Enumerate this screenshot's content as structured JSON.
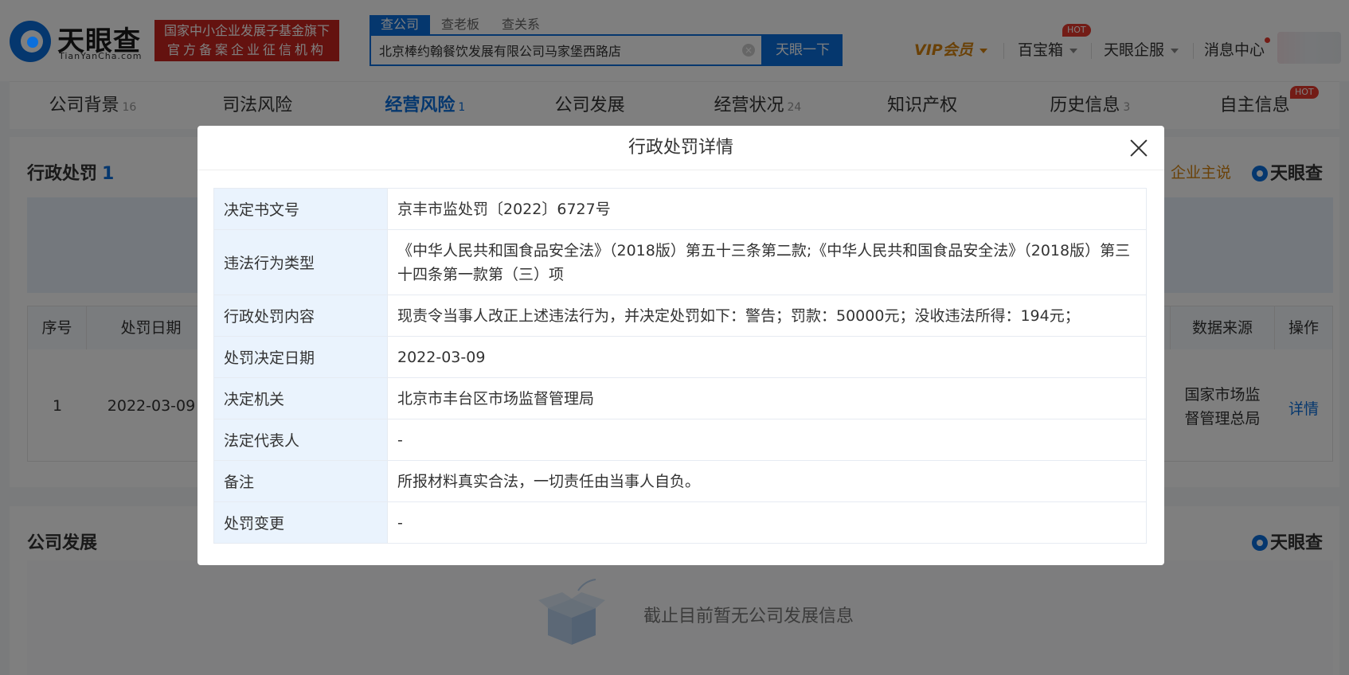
{
  "header": {
    "logo_text": "天眼查",
    "logo_sub": "TianYanCha.com",
    "badge_line1": "国家中小企业发展子基金旗下",
    "badge_line2": "官方备案企业征信机构",
    "search_tabs": [
      "查公司",
      "查老板",
      "查关系"
    ],
    "search_value": "北京棒约翰餐饮发展有限公司马家堡西路店",
    "search_clear": "×",
    "search_button": "天眼一下",
    "nav": {
      "vip": "VIP会员",
      "baobao": "百宝箱",
      "qifu": "天眼企服",
      "messages": "消息中心",
      "hot": "HOT"
    }
  },
  "tabs": [
    {
      "label": "公司背景",
      "count": "16"
    },
    {
      "label": "司法风险",
      "count": ""
    },
    {
      "label": "经营风险",
      "count": "1"
    },
    {
      "label": "公司发展",
      "count": ""
    },
    {
      "label": "经营状况",
      "count": "24"
    },
    {
      "label": "知识产权",
      "count": ""
    },
    {
      "label": "历史信息",
      "count": "3"
    },
    {
      "label": "自主信息",
      "count": ""
    }
  ],
  "tab_hot": "HOT",
  "penalty_section": {
    "title": "行政处罚",
    "count": "1",
    "qiye_zhushuo": "企业主说",
    "brand": "天眼查",
    "table_headers": {
      "index": "序号",
      "date": "处罚日期",
      "source": "数据来源",
      "action": "操作"
    },
    "row": {
      "index": "1",
      "date": "2022-03-09",
      "source_line1": "国家市场监",
      "source_line2": "督管理总局",
      "action": "详情"
    }
  },
  "dev_section": {
    "title": "公司发展",
    "brand": "天眼查",
    "empty_text": "截止目前暂无公司发展信息"
  },
  "modal": {
    "title": "行政处罚详情",
    "rows": [
      {
        "label": "决定书文号",
        "value": "京丰市监处罚〔2022〕6727号"
      },
      {
        "label": "违法行为类型",
        "value": "《中华人民共和国食品安全法》（2018版）第五十三条第二款;《中华人民共和国食品安全法》（2018版）第三十四条第一款第（三）项"
      },
      {
        "label": "行政处罚内容",
        "value": "现责令当事人改正上述违法行为，并决定处罚如下：警告；罚款：50000元；没收违法所得：194元；"
      },
      {
        "label": "处罚决定日期",
        "value": "2022-03-09"
      },
      {
        "label": "决定机关",
        "value": "北京市丰台区市场监督管理局"
      },
      {
        "label": "法定代表人",
        "value": "-"
      },
      {
        "label": "备注",
        "value": "所报材料真实合法，一切责任由当事人自负。"
      },
      {
        "label": "处罚变更",
        "value": "-"
      }
    ]
  },
  "colors": {
    "brand_blue": "#0b6fdc",
    "badge_red": "#c8251f",
    "vip_gold": "#d4830f",
    "hot_red": "#e7382c",
    "label_bg": "#eaf3fd"
  }
}
